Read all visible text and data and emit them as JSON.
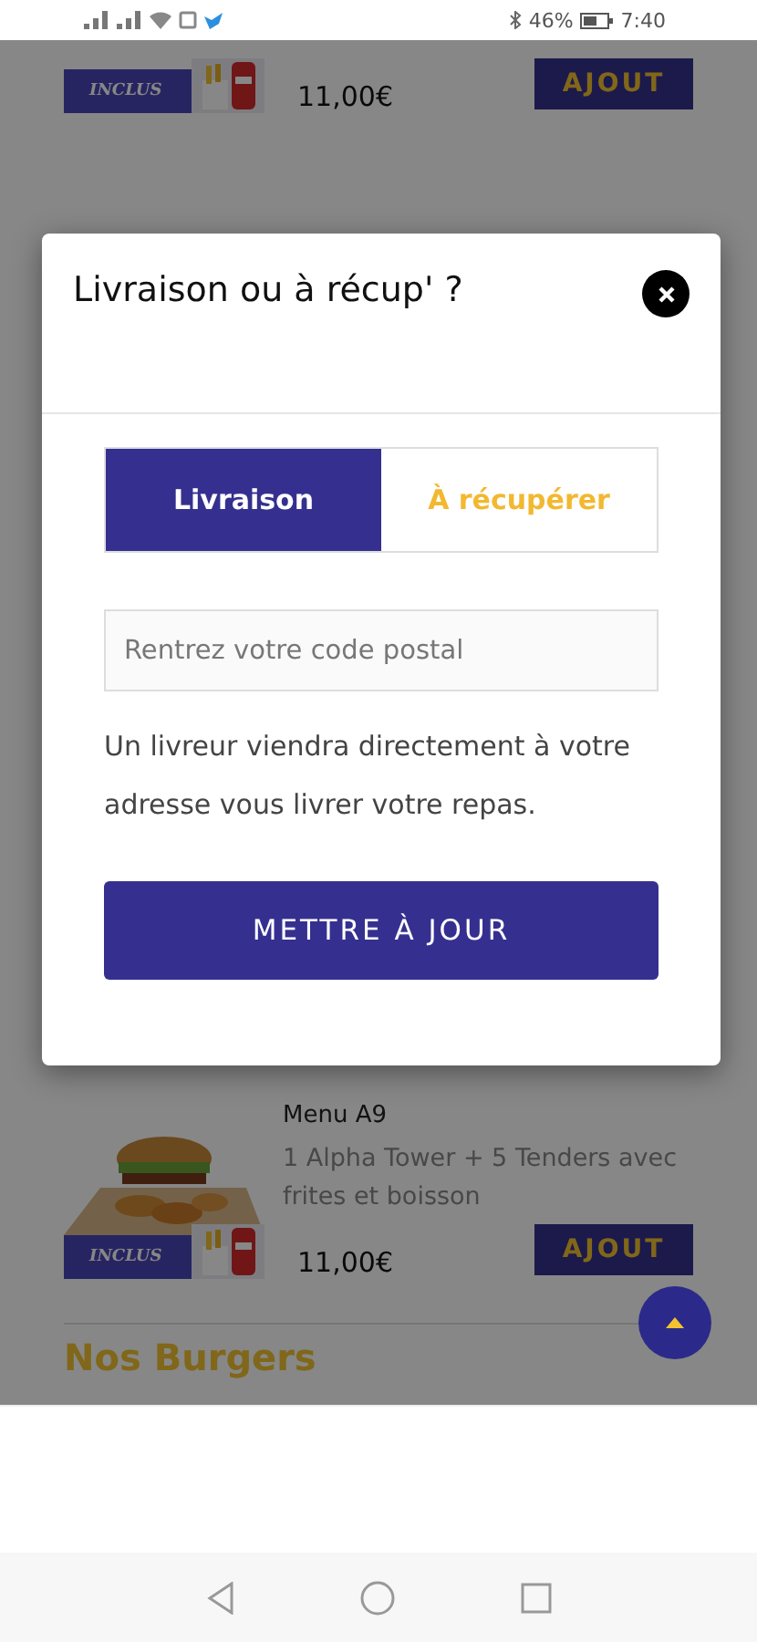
{
  "status_bar": {
    "battery": "46%",
    "time": "7:40"
  },
  "menu_items": [
    {
      "badge": "INCLUS",
      "price": "11,00€",
      "button": "AJOUT"
    },
    {
      "name": "Menu A9",
      "description": "1 Alpha Tower + 5 Tenders avec frites et boisson",
      "badge": "INCLUS",
      "price": "11,00€",
      "button": "AJOUT"
    }
  ],
  "section_title": "Nos Burgers",
  "modal": {
    "title": "Livraison ou à récup' ?",
    "tabs": [
      {
        "label": "Livraison",
        "selected": true
      },
      {
        "label": "À récupérer",
        "selected": false
      }
    ],
    "postal_field": {
      "placeholder": "Rentrez votre code postal"
    },
    "info": "Un livreur viendra directement à votre adresse vous livrer votre repas.",
    "button": "METTRE À JOUR"
  }
}
